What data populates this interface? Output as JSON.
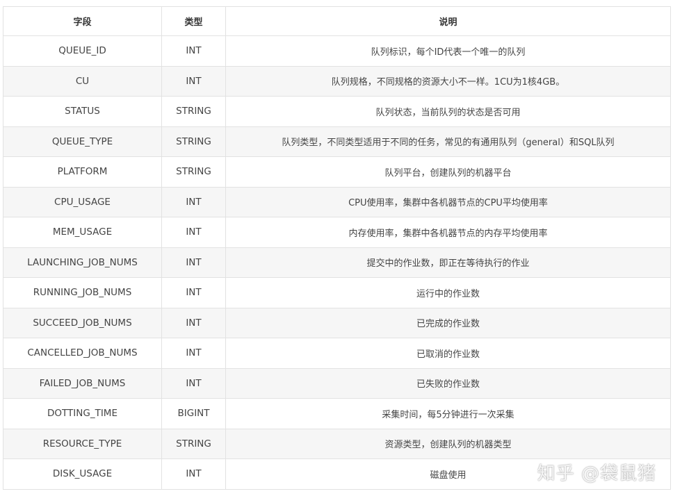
{
  "table": {
    "headers": [
      "字段",
      "类型",
      "说明"
    ],
    "rows": [
      {
        "field": "QUEUE_ID",
        "type": "INT",
        "desc": "队列标识，每个ID代表一个唯一的队列"
      },
      {
        "field": "CU",
        "type": "INT",
        "desc": "队列规格，不同规格的资源大小不一样。1CU为1核4GB。"
      },
      {
        "field": "STATUS",
        "type": "STRING",
        "desc": "队列状态，当前队列的状态是否可用"
      },
      {
        "field": "QUEUE_TYPE",
        "type": "STRING",
        "desc": "队列类型，不同类型适用于不同的任务，常见的有通用队列（general）和SQL队列"
      },
      {
        "field": "PLATFORM",
        "type": "STRING",
        "desc": "队列平台，创建队列的机器平台"
      },
      {
        "field": "CPU_USAGE",
        "type": "INT",
        "desc": "CPU使用率，集群中各机器节点的CPU平均使用率"
      },
      {
        "field": "MEM_USAGE",
        "type": "INT",
        "desc": "内存使用率，集群中各机器节点的内存平均使用率"
      },
      {
        "field": "LAUNCHING_JOB_NUMS",
        "type": "INT",
        "desc": "提交中的作业数，即正在等待执行的作业"
      },
      {
        "field": "RUNNING_JOB_NUMS",
        "type": "INT",
        "desc": "运行中的作业数"
      },
      {
        "field": "SUCCEED_JOB_NUMS",
        "type": "INT",
        "desc": "已完成的作业数"
      },
      {
        "field": "CANCELLED_JOB_NUMS",
        "type": "INT",
        "desc": "已取消的作业数"
      },
      {
        "field": "FAILED_JOB_NUMS",
        "type": "INT",
        "desc": "已失败的作业数"
      },
      {
        "field": "DOTTING_TIME",
        "type": "BIGINT",
        "desc": "采集时间，每5分钟进行一次采集"
      },
      {
        "field": "RESOURCE_TYPE",
        "type": "STRING",
        "desc": "资源类型，创建队列的机器类型"
      },
      {
        "field": "DISK_USAGE",
        "type": "INT",
        "desc": "磁盘使用"
      }
    ]
  },
  "watermark": "知乎 @袋鼠猪"
}
